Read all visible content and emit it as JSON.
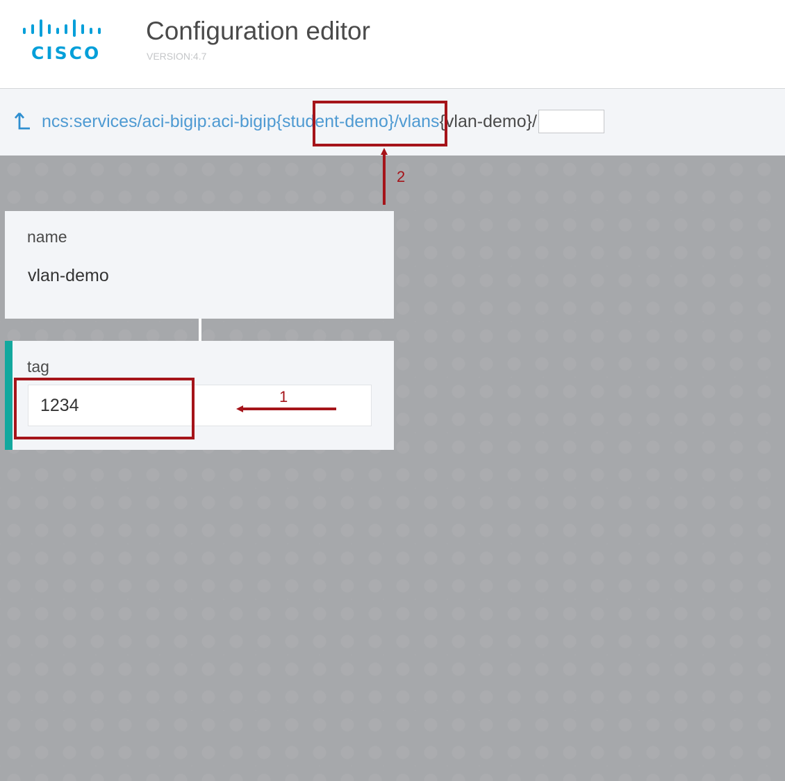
{
  "header": {
    "logo_text": "CISCO",
    "title": "Configuration editor",
    "version": "VERSION:4.7"
  },
  "breadcrumb": {
    "path_link": "ncs:services/aci-bigip:aci-bigip",
    "key_open": "{",
    "key_value": "student-demo",
    "key_close": "}",
    "list_link": "/vlans",
    "current": "{vlan-demo}/",
    "input_value": "",
    "up_icon": "up-arrow-icon"
  },
  "cards": {
    "name": {
      "label": "name",
      "value": "vlan-demo"
    },
    "tag": {
      "label": "tag",
      "value": "1234",
      "accent_color": "#13a89e"
    }
  },
  "annotations": {
    "color": "#a5141a",
    "marker_1": "1",
    "marker_2": "2"
  }
}
